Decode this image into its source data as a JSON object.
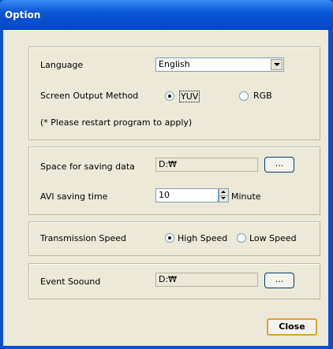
{
  "window": {
    "title": "Option"
  },
  "language": {
    "label": "Language",
    "selected": "English"
  },
  "screen_output": {
    "label": "Screen Output Method",
    "options": [
      {
        "label": "YUV",
        "checked": true
      },
      {
        "label": "RGB",
        "checked": false
      }
    ],
    "note": "(* Please restart program to apply)"
  },
  "saving": {
    "space_label": "Space for saving data",
    "space_path": "D:₩",
    "browse_label": "...",
    "avi_label": "AVI saving time",
    "avi_value": "10",
    "avi_unit": "Minute"
  },
  "transmission": {
    "label": "Transmission Speed",
    "options": [
      {
        "label": "High Speed",
        "checked": true
      },
      {
        "label": "Low Speed",
        "checked": false
      }
    ]
  },
  "event_sound": {
    "label": "Event Soound",
    "path": "D:₩",
    "browse_label": "..."
  },
  "buttons": {
    "close": "Close"
  }
}
